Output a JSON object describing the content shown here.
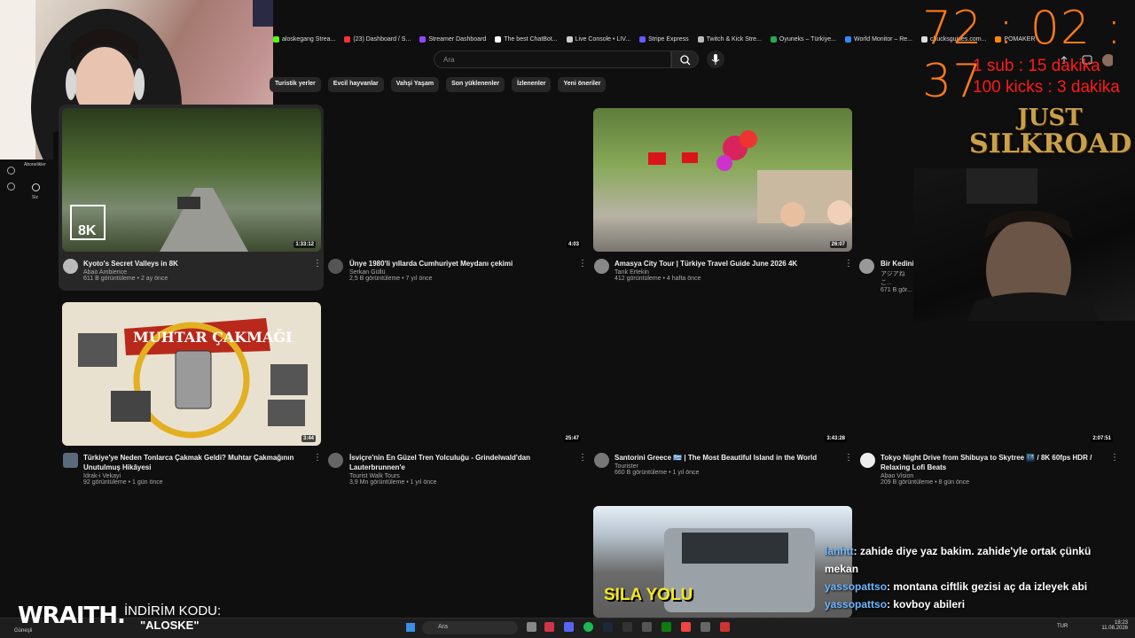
{
  "bookmarks": [
    {
      "label": "aloskegang Strea...",
      "color": "#53fc18"
    },
    {
      "label": "(23) Dashboard / S...",
      "color": "#ff3333"
    },
    {
      "label": "Streamer Dashboard",
      "color": "#9147ff"
    },
    {
      "label": "The best ChatBot...",
      "color": "#ffffff"
    },
    {
      "label": "Live Console • LIV...",
      "color": "#cccccc"
    },
    {
      "label": "Stripe Express",
      "color": "#635bff"
    },
    {
      "label": "Twitch & Kick Stre...",
      "color": "#bbbbbb"
    },
    {
      "label": "Oyuneks – Türkiye...",
      "color": "#22aa55"
    },
    {
      "label": "World Monitor – Re...",
      "color": "#3388ff"
    },
    {
      "label": "chucksguides.com...",
      "color": "#dddddd"
    },
    {
      "label": "POMAKER",
      "color": "#ff8800"
    }
  ],
  "search": {
    "placeholder": "Ara"
  },
  "chips": [
    "Turistik yerler",
    "Evcil hayvanlar",
    "Vahşi Yaşam",
    "Son yüklenenler",
    "İzlenenler",
    "Yeni öneriler"
  ],
  "sidebar": {
    "subscriptions_label": "Abonelikler",
    "you_label": "Siz"
  },
  "videos": [
    {
      "title": "Kyoto's Secret Valleys in 8K",
      "channel": "Abao Ambience",
      "meta": "611 B görüntüleme • 2 ay önce",
      "duration": "1:33:12",
      "badge": "8K"
    },
    {
      "title": "Ünye 1980'li yıllarda  Cumhuriyet Meydanı çekimi",
      "channel": "Serkan Güllü",
      "meta": "2,5 B görüntüleme • 7 yıl önce",
      "duration": "4:03"
    },
    {
      "title": "Amasya City Tour | Türkiye Travel Guide June 2026 4K",
      "channel": "Tarık Ertekin",
      "meta": "412 görüntüleme • 4 hafta önce",
      "duration": "26:07"
    },
    {
      "title": "Bir Kedinin...",
      "channel": "アジアねこ...",
      "meta": "671 B gör...",
      "duration": ""
    },
    {
      "title": "Türkiye'ye Neden Tonlarca Çakmak Geldi? Muhtar Çakmağının Unutulmuş Hikâyesi",
      "channel": "İdrak-i Vekayi",
      "meta": "92 görüntüleme • 1 gün önce",
      "duration": "3:44",
      "thumb_text": "MUHTAR ÇAKMAĞI"
    },
    {
      "title": "İsviçre'nin En Güzel Tren Yolculuğu - Grindelwald'dan Lauterbrunnen'e",
      "channel": "Tourist Walk Tours",
      "meta": "3,9 Mn görüntüleme • 1 yıl önce",
      "duration": "25:47"
    },
    {
      "title": "Santorini Greece 🇬🇷 | The Most Beautiful Island in the World",
      "channel": "Tourister",
      "meta": "660 B görüntüleme • 1 yıl önce",
      "duration": "3:43:28"
    },
    {
      "title": "Tokyo Night Drive from Shibuya to Skytree 🌃 / 8K 60fps HDR / Relaxing Lofi Beats",
      "channel": "Abao Vision",
      "meta": "209 B görüntüleme • 8 gün önce",
      "duration": "2:07:51"
    },
    {
      "thumb_text": "SILA YOLU"
    }
  ],
  "overlay": {
    "timer": "72 : 02 : 37",
    "sub_line": "1 sub : 15 dakika",
    "kicks_line": "100 kicks : 3 dakika",
    "logo_line1": "JUST",
    "logo_line2": "SILKROAD",
    "brand": "WRAITH.",
    "promo_label": "İNDİRİM KODU:",
    "promo_code": "\"ALOSKE\""
  },
  "chat": [
    {
      "user": "lanhtt",
      "message": ": zahide diye yaz bakim. zahide'yle ortak çünkü mekan"
    },
    {
      "user": "yassopattso",
      "message": ": montana ciftlik gezisi aç da izleyek abi"
    },
    {
      "user": "yassopattso",
      "message": ": kovboy abileri"
    }
  ],
  "taskbar": {
    "search_placeholder": "Ara",
    "lang": "TUR",
    "time": "18:23",
    "date": "11.08.2026",
    "weather": "Güneşli"
  }
}
